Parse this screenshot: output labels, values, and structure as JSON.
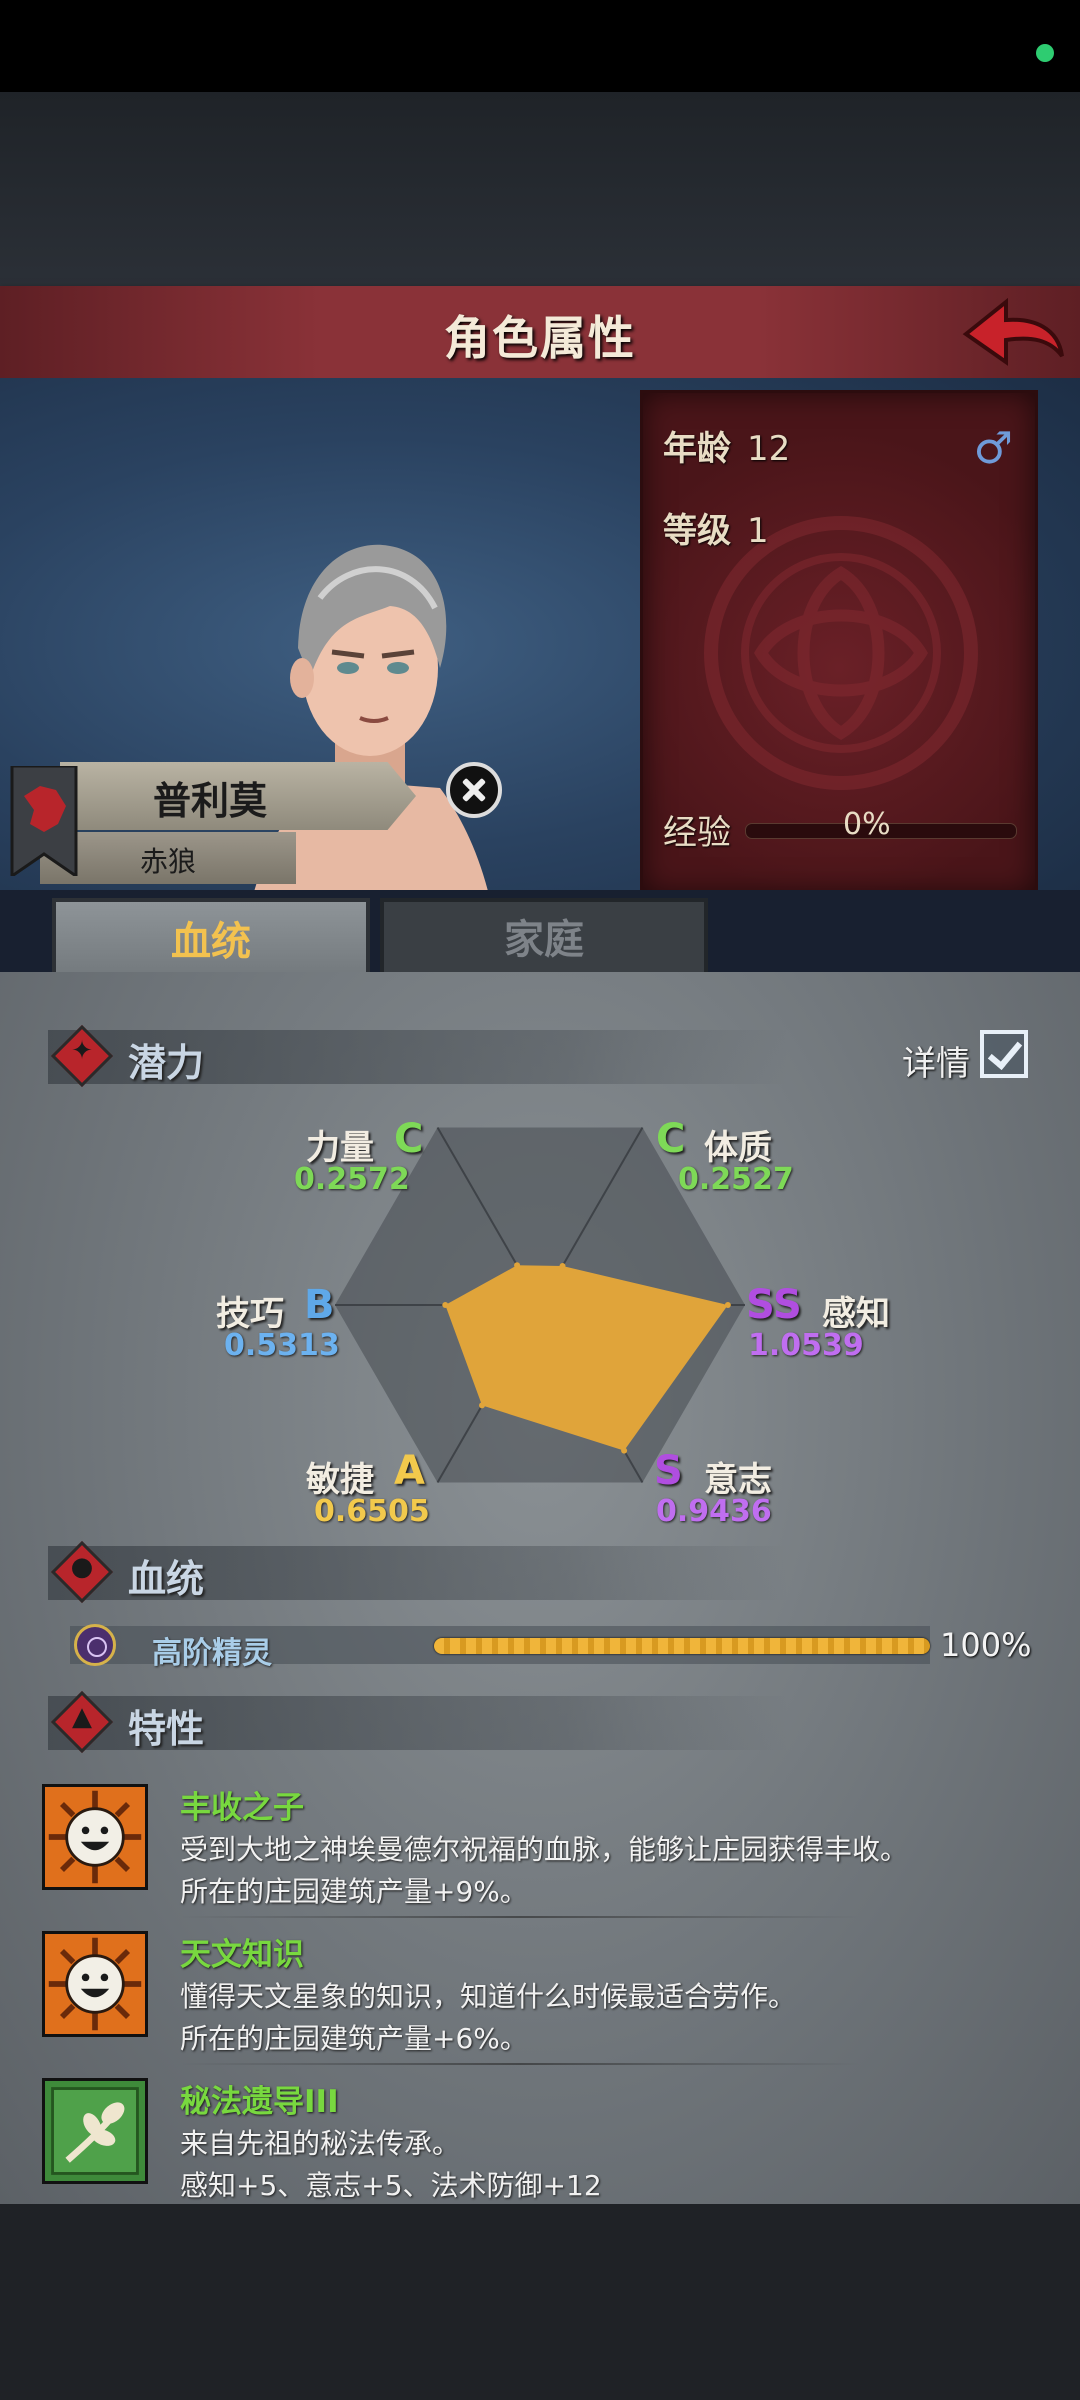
{
  "header": {
    "title": "角色属性"
  },
  "character": {
    "name": "普利莫",
    "title": "赤狼",
    "age_label": "年龄",
    "age": "12",
    "level_label": "等级",
    "level": "1",
    "gender_icon": "male-symbol-icon",
    "exp_label": "经验",
    "exp": "0%"
  },
  "tabs": [
    {
      "label": "血统",
      "active": true
    },
    {
      "label": "家庭",
      "active": false
    }
  ],
  "potential": {
    "title": "潜力",
    "detail_label": "详情",
    "detail_checked": true,
    "stats": [
      {
        "name": "力量",
        "grade": "C",
        "value": "0.2572",
        "num": 0.2572,
        "grade_color": "#7ed957",
        "value_color": "#7ed957"
      },
      {
        "name": "体质",
        "grade": "C",
        "value": "0.2527",
        "num": 0.2527,
        "grade_color": "#7ed957",
        "value_color": "#7ed957"
      },
      {
        "name": "感知",
        "grade": "SS",
        "value": "1.0539",
        "num": 1.0539,
        "grade_color": "#b04ee0",
        "value_color": "#c06ef0"
      },
      {
        "name": "意志",
        "grade": "S",
        "value": "0.9436",
        "num": 0.9436,
        "grade_color": "#b04ee0",
        "value_color": "#c06ef0"
      },
      {
        "name": "敏捷",
        "grade": "A",
        "value": "0.6505",
        "num": 0.6505,
        "grade_color": "#f2c94c",
        "value_color": "#f2c94c"
      },
      {
        "name": "技巧",
        "grade": "B",
        "value": "0.5313",
        "num": 0.5313,
        "grade_color": "#5fa8e8",
        "value_color": "#6cb2f0"
      }
    ],
    "fill_color": "#e0a43a"
  },
  "bloodline": {
    "title": "血统",
    "name": "高阶精灵",
    "percent": "100%",
    "fill": 1.0
  },
  "traits": {
    "title": "特性",
    "items": [
      {
        "name": "丰收之子",
        "desc": "受到大地之神埃曼德尔祝福的血脉，能够让庄园获得丰收。",
        "effect": "所在的庄园建筑产量+9%。",
        "icon": "smiling-sun-icon"
      },
      {
        "name": "天文知识",
        "desc": "懂得天文星象的知识，知道什么时候最适合劳作。",
        "effect": "所在的庄园建筑产量+6%。",
        "icon": "smiling-sun-icon"
      },
      {
        "name": "秘法遗导III",
        "desc": "来自先祖的秘法传承。",
        "effect": "感知+5、意志+5、法术防御+12",
        "icon": "leaf-branch-icon"
      }
    ]
  }
}
